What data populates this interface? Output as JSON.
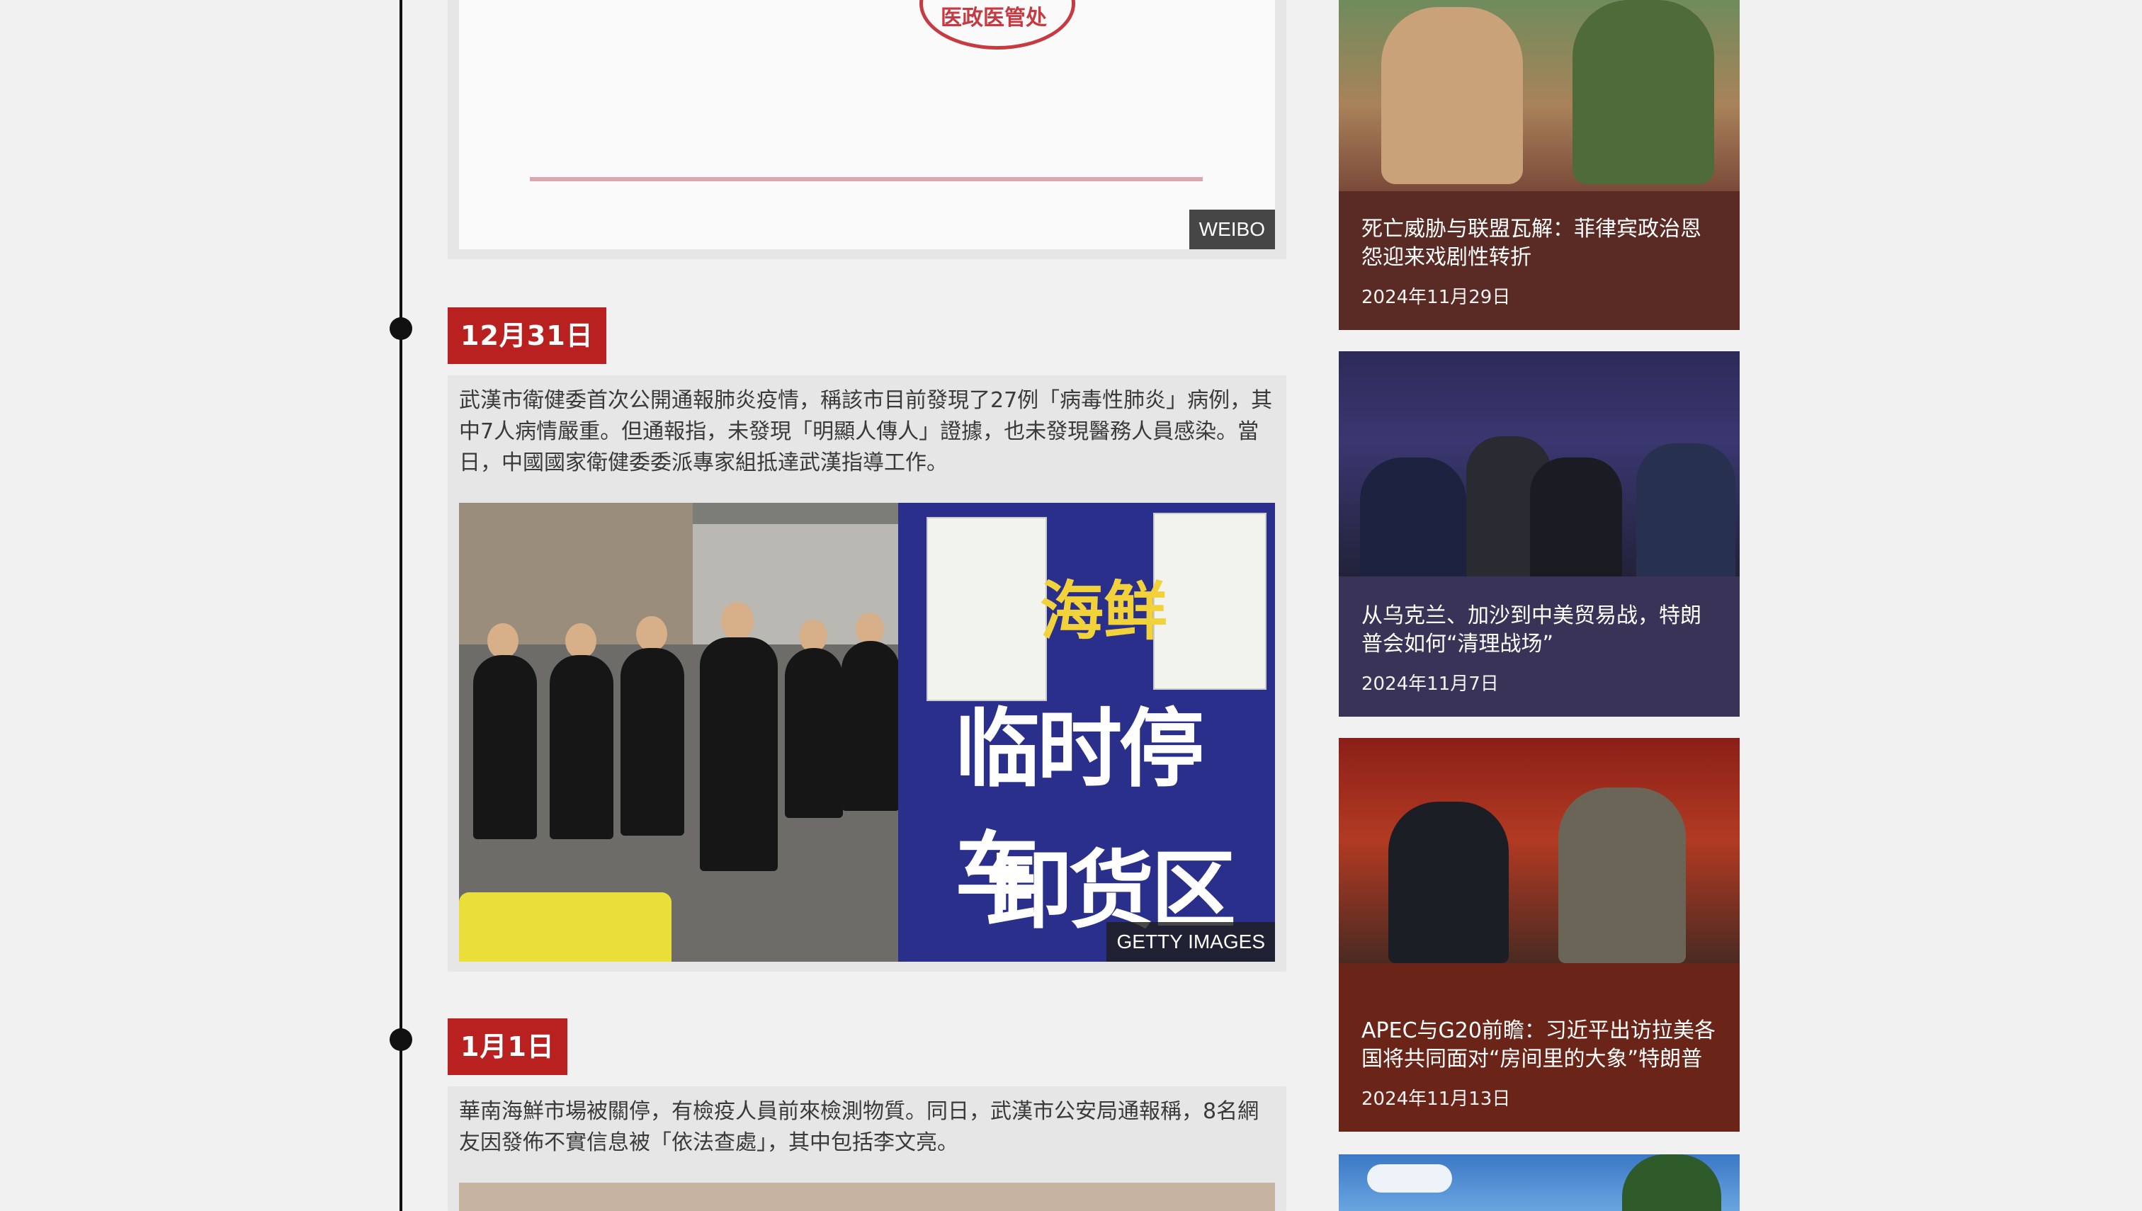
{
  "timeline": {
    "entries": [
      {
        "credit": "WEIBO",
        "stamp_text": "医政医管处"
      },
      {
        "date": "12月31日",
        "text": "武漢市衛健委首次公開通報肺炎疫情，稱該市目前發現了27例「病毒性肺炎」病例，其中7人病情嚴重。但通報指，未發現「明顯人傳人」證據，也未發現醫務人員感染。當日，中國國家衛健委委派專家組抵達武漢指導工作。",
        "credit": "GETTY IMAGES",
        "sign_line1": "临时停车",
        "sign_line2": "卸货区",
        "sign_top": "海鲜"
      },
      {
        "date": "1月1日",
        "text": "華南海鮮市場被關停，有檢疫人員前來檢測物質。同日，武漢市公安局通報稱，8名網友因發佈不實信息被「依法查處」，其中包括李文亮。"
      }
    ]
  },
  "sidebar": {
    "items": [
      {
        "title": "死亡威胁与联盟瓦解：菲律宾政治恩怨迎来戏剧性转折",
        "date": "2024年11月29日",
        "accent": "#5a2a24"
      },
      {
        "title": "从乌克兰、加沙到中美贸易战，特朗普会如何“清理战场”",
        "date": "2024年11月7日",
        "accent": "#3a3358"
      },
      {
        "title": "APEC与G20前瞻：习近平出访拉美各国将共同面对“房间里的大象”特朗普",
        "date": "2024年11月13日",
        "accent": "#6a2418"
      }
    ]
  },
  "colors": {
    "date_tag": "#b8211f",
    "timeline": "#111111",
    "card_bg": "#e6e6e6",
    "page_bg": "#f1f1f1"
  }
}
